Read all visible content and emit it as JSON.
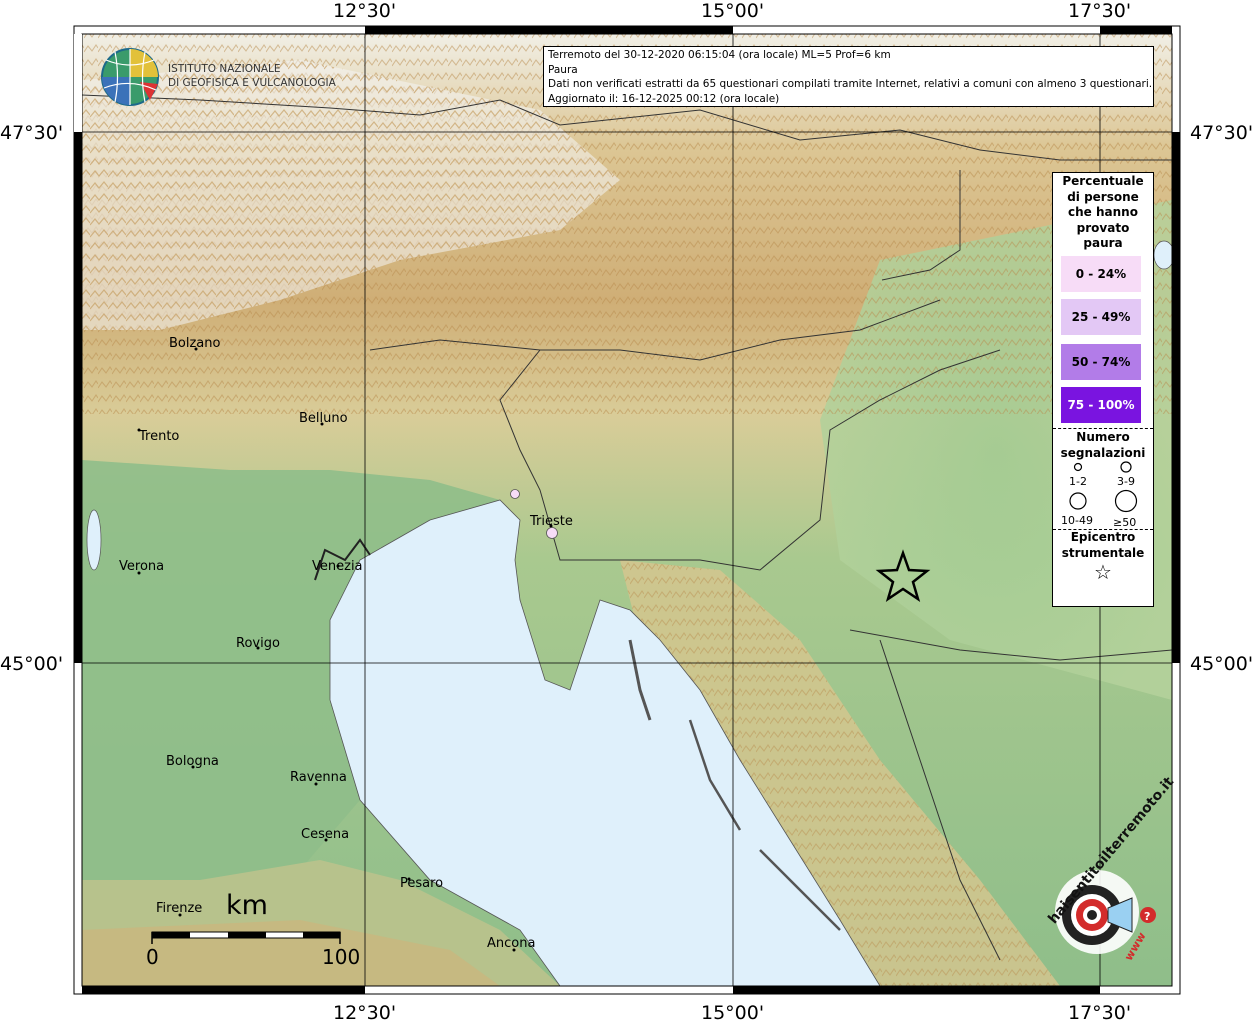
{
  "map": {
    "lon_ticks": [
      "12°30'",
      "15°00'",
      "17°30'"
    ],
    "lat_ticks": [
      "47°30'",
      "45°00'"
    ],
    "colors": {
      "sea": "#dff0fb",
      "land_low": "#8fbe8a",
      "land_mid": "#e4d9a6",
      "land_high": "#c9a46a",
      "snow": "#f4f4f4"
    }
  },
  "logo": {
    "line1": "ISTITUTO NAZIONALE",
    "line2": "DI GEOFISICA E VULCANOLOGIA"
  },
  "info": {
    "line1": "Terremoto del 30-12-2020 06:15:04 (ora locale) ML=5 Prof=6 km",
    "line2": "Paura",
    "line3": "Dati non verificati estratti da 65 questionari compilati tramite Internet, relativi a comuni con almeno 3 questionari.",
    "line4": "Aggiornato il: 16-12-2025 00:12 (ora locale)"
  },
  "cities": [
    {
      "name": "Bolzano"
    },
    {
      "name": "Trento"
    },
    {
      "name": "Belluno"
    },
    {
      "name": "Trieste"
    },
    {
      "name": "Verona"
    },
    {
      "name": "Venezia"
    },
    {
      "name": "Rovigo"
    },
    {
      "name": "Bologna"
    },
    {
      "name": "Ravenna"
    },
    {
      "name": "Cesena"
    },
    {
      "name": "Pesaro"
    },
    {
      "name": "Firenze"
    },
    {
      "name": "Ancona"
    }
  ],
  "legend": {
    "title": [
      "Percentuale",
      "di persone",
      "che hanno",
      "provato",
      "paura"
    ],
    "classes": [
      {
        "label": "0 - 24%",
        "color": "#f7dcf7",
        "text": "#000"
      },
      {
        "label": "25 - 49%",
        "color": "#e3c8f5",
        "text": "#000"
      },
      {
        "label": "50 - 74%",
        "color": "#b27ce8",
        "text": "#000"
      },
      {
        "label": "75 - 100%",
        "color": "#7a14e0",
        "text": "#fff"
      }
    ],
    "count_title": [
      "Numero",
      "segnalazioni"
    ],
    "counts": [
      "1-2",
      "3-9",
      "10-49",
      "≥50"
    ],
    "epi_title": [
      "Epicentro",
      "strumentale"
    ],
    "epi_symbol": "☆"
  },
  "scale": {
    "unit": "km",
    "start": "0",
    "end": "100"
  },
  "badge": {
    "text": "haisentitoilterremoto.it",
    "www": "www"
  }
}
